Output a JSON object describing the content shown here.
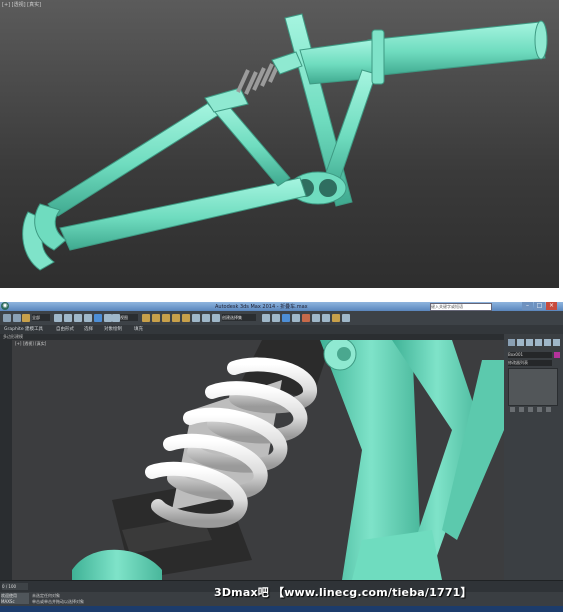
{
  "top_viewport": {
    "label": "[+] [透视] [真实]"
  },
  "window": {
    "app_icon": "3ds-max-logo-icon",
    "title": "Autodesk 3ds Max 2014 - 折叠车.max",
    "search_placeholder": "键入关键字或短语",
    "controls": {
      "minimize": "–",
      "maximize": "□",
      "close": "×"
    }
  },
  "toolbar": {
    "dropdown_1": "全部",
    "dropdown_2": "视图",
    "dropdown_3": "创建选择集"
  },
  "ribbon": {
    "tabs": [
      "Graphite 建模工具",
      "自由形式",
      "选择",
      "对象绘制",
      "填充"
    ]
  },
  "sub_bar": {
    "label": "多边形建模"
  },
  "viewport": {
    "label": "[+] [透视] [真实]"
  },
  "command_panel": {
    "object_name": "Box001",
    "modifier_list": "修改器列表",
    "accent_color": "#b5329b"
  },
  "timeline": {
    "frame_counter": "0 / 100"
  },
  "status": {
    "line1": "未选定任何对象",
    "line2": "单击或单击并拖动以选择对象",
    "maxscript_label": "欢迎使用 MAXSc"
  },
  "watermark": "3Dmax吧 【www.linecg.com/tieba/1771】",
  "colors": {
    "frame_mint": "#7fe3c9",
    "spring_white": "#e8e8e8",
    "shock_dark": "#2b2b2b"
  }
}
